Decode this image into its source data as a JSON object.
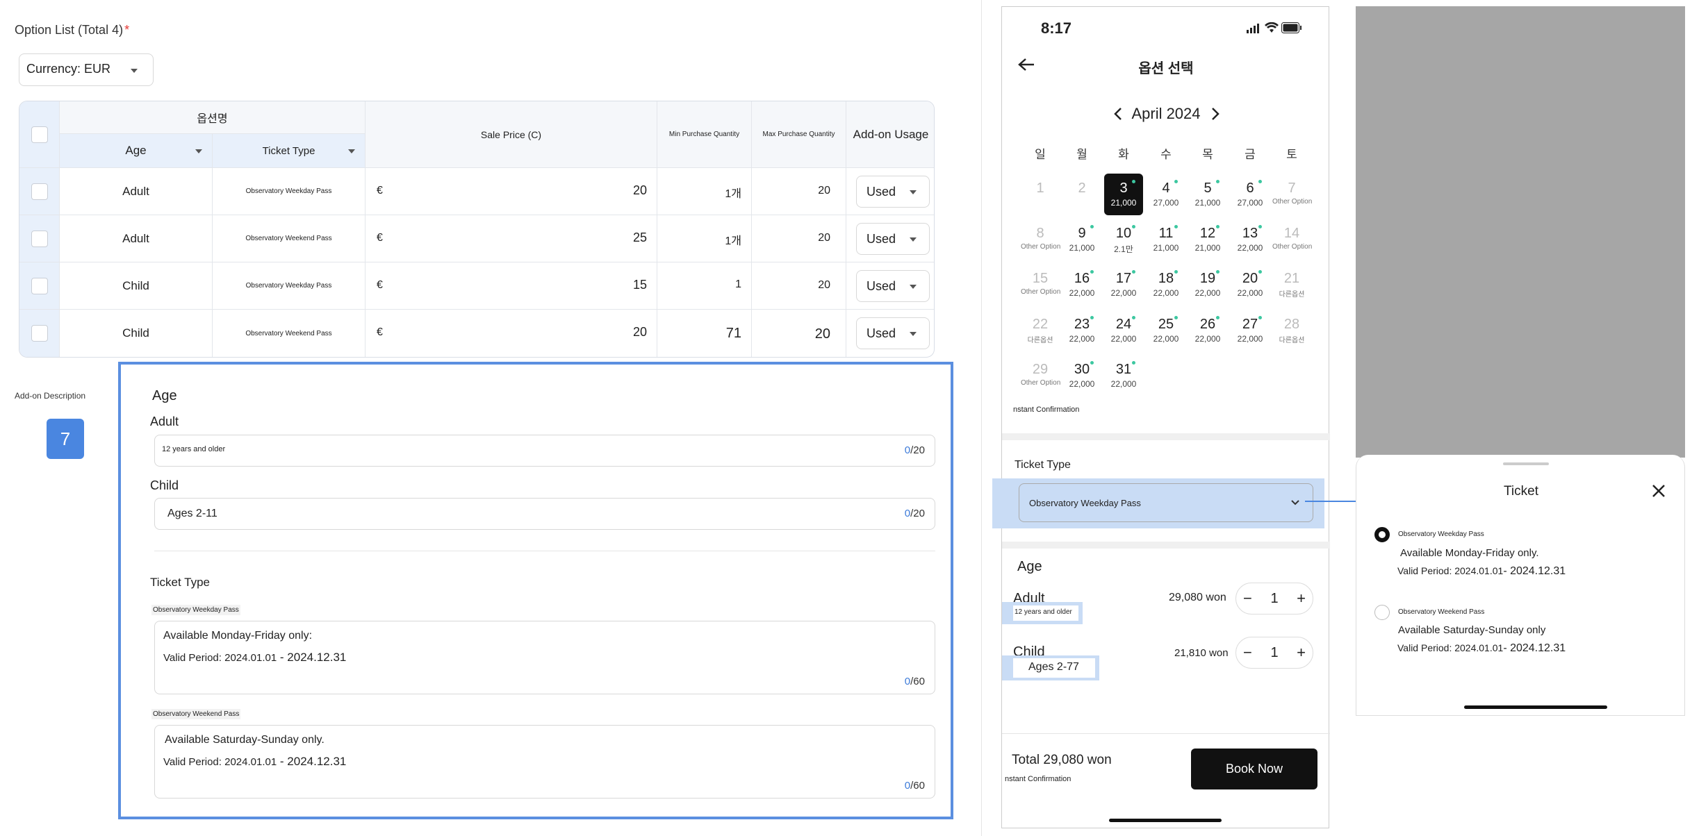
{
  "option_list": {
    "title": "Option List (Total 4)",
    "required_mark": "*"
  },
  "currency": {
    "label": "Currency: EUR"
  },
  "table": {
    "group_header": "옵션명",
    "headers": {
      "age": "Age",
      "ticket_type": "Ticket Type",
      "sale_price": "Sale Price (C)",
      "min_qty": "Min Purchase Quantity",
      "max_qty": "Max Purchase Quantity",
      "addon": "Add-on Usage"
    },
    "rows": [
      {
        "age": "Adult",
        "ticket": "Observatory Weekday Pass",
        "currency": "€",
        "price": "20",
        "min": "1개",
        "max": "20",
        "usage": "Used"
      },
      {
        "age": "Adult",
        "ticket": "Observatory Weekend Pass",
        "currency": "€",
        "price": "25",
        "min": "1개",
        "max": "20",
        "usage": "Used"
      },
      {
        "age": "Child",
        "ticket": "Observatory Weekday Pass",
        "currency": "€",
        "price": "15",
        "min": "1",
        "max": "20",
        "usage": "Used"
      },
      {
        "age": "Child",
        "ticket": "Observatory Weekend Pass",
        "currency": "€",
        "price": "20",
        "min": "71",
        "max": "20",
        "usage": "Used"
      }
    ]
  },
  "addon": {
    "label": "Add-on Description",
    "badge": "7",
    "age_title": "Age",
    "adult_label": "Adult",
    "adult_value": "12 years and older",
    "adult_count": "0",
    "adult_max": "/20",
    "child_label": "Child",
    "child_value": "Ages 2-11",
    "child_count": "0",
    "child_max": "/20",
    "ticket_title": "Ticket Type",
    "weekday_label": "Observatory Weekday Pass",
    "weekday_line1": "Available Monday-Friday only:",
    "weekday_line2a": "Valid Period: 2024.01.01",
    "weekday_line2b": " - 2024.12.31",
    "weekday_count": "0",
    "weekday_max": "/60",
    "weekend_label": "Observatory Weekend Pass",
    "weekend_line1": "Available Saturday-Sunday only.",
    "weekend_line2a": "Valid Period: 2024.01.01",
    "weekend_line2b": " - 2024.12.31",
    "weekend_count": "0",
    "weekend_max": "/60"
  },
  "phone": {
    "time": "8:17",
    "title": "옵션 선택",
    "month": "April 2024",
    "weekdays": [
      "일",
      "월",
      "화",
      "수",
      "목",
      "금",
      "토"
    ],
    "days": [
      {
        "d": "1",
        "p": "",
        "dis": true
      },
      {
        "d": "2",
        "p": "",
        "dis": true
      },
      {
        "d": "3",
        "p": "21,000",
        "sel": true,
        "dot": true
      },
      {
        "d": "4",
        "p": "27,000",
        "dot": true
      },
      {
        "d": "5",
        "p": "21,000",
        "dot": true
      },
      {
        "d": "6",
        "p": "27,000",
        "dot": true
      },
      {
        "d": "7",
        "p": "Other Option",
        "dis": true
      },
      {
        "d": "8",
        "p": "Other Option",
        "dis": true
      },
      {
        "d": "9",
        "p": "21,000",
        "dot": true
      },
      {
        "d": "10",
        "p": "2.1만",
        "dot": true
      },
      {
        "d": "11",
        "p": "21,000",
        "dot": true
      },
      {
        "d": "12",
        "p": "21,000",
        "dot": true
      },
      {
        "d": "13",
        "p": "22,000",
        "dot": true
      },
      {
        "d": "14",
        "p": "Other Option",
        "dis": true
      },
      {
        "d": "15",
        "p": "Other Option",
        "dis": true
      },
      {
        "d": "16",
        "p": "22,000",
        "dot": true
      },
      {
        "d": "17",
        "p": "22,000",
        "dot": true
      },
      {
        "d": "18",
        "p": "22,000",
        "dot": true
      },
      {
        "d": "19",
        "p": "22,000",
        "dot": true
      },
      {
        "d": "20",
        "p": "22,000",
        "dot": true
      },
      {
        "d": "21",
        "p": "다른옵션",
        "dis": true
      },
      {
        "d": "22",
        "p": "다른옵션",
        "dis": true
      },
      {
        "d": "23",
        "p": "22,000",
        "dot": true
      },
      {
        "d": "24",
        "p": "22,000",
        "dot": true
      },
      {
        "d": "25",
        "p": "22,000",
        "dot": true
      },
      {
        "d": "26",
        "p": "22,000",
        "dot": true
      },
      {
        "d": "27",
        "p": "22,000",
        "dot": true
      },
      {
        "d": "28",
        "p": "다른옵션",
        "dis": true
      },
      {
        "d": "29",
        "p": "Other Option",
        "dis": true
      },
      {
        "d": "30",
        "p": "22,000",
        "dot": true
      },
      {
        "d": "31",
        "p": "22,000",
        "dot": true
      }
    ],
    "instant": "nstant Confirmation",
    "ticket_label": "Ticket Type",
    "ticket_value": "Observatory Weekday Pass",
    "age_title": "Age",
    "adult_label": "Adult",
    "adult_sub": "12 years and older",
    "adult_price": "29,080 won",
    "adult_qty": "1",
    "child_label": "Child",
    "child_sub": "Ages 2-77",
    "child_price": "21,810 won",
    "child_qty": "1",
    "total": "Total 29,080 won",
    "instant2": "nstant Confirmation",
    "book": "Book Now"
  },
  "sheet": {
    "title": "Ticket",
    "opt1_name": "Observatory Weekday Pass",
    "opt1_line1": "Available Monday-Friday only.",
    "opt1_line2a": "Valid Period: 2024.01.01",
    "opt1_line2b": "- 2024.12.31",
    "opt2_name": "Observatory Weekend Pass",
    "opt2_line1": "Available Saturday-Sunday only",
    "opt2_line2a": "Valid Period: 2024.01.01",
    "opt2_line2b": "- 2024.12.31"
  },
  "colors": {
    "accent": "#4a86e0",
    "highlight": "#c9dcf5",
    "dot": "#3cc7a0",
    "required": "#e53935"
  }
}
